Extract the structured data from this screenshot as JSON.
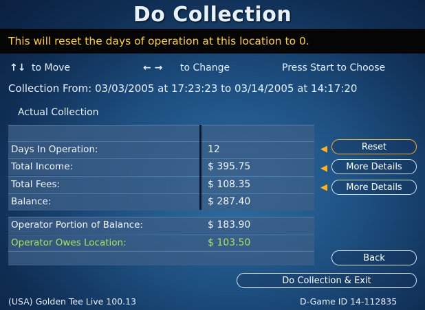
{
  "title": "Do Collection",
  "banner": "This will reset the days of operation at this location to 0.",
  "controls": {
    "move_icon": "↑↓",
    "move_label": "to Move",
    "change_icon": "← →",
    "change_label": "to Change",
    "start_label": "Press Start to Choose"
  },
  "collection_from": "Collection From: 03/03/2005 at 17:23:23 to 03/14/2005 at 14:17:20",
  "actual_label": "Actual Collection",
  "rows": [
    {
      "label": "",
      "value": ""
    },
    {
      "label": "Days In Operation:",
      "value": "12"
    },
    {
      "label": "Total Income:",
      "value": "$ 395.75"
    },
    {
      "label": "Total Fees:",
      "value": "$ 108.35"
    },
    {
      "label": "Balance:",
      "value": "$ 287.40"
    },
    {
      "label": "Operator Portion of Balance:",
      "value": "$ 183.90"
    },
    {
      "label": "Operator Owes Location:",
      "value": "$ 103.50"
    }
  ],
  "buttons": {
    "reset": "Reset",
    "more_details_1": "More Details",
    "more_details_2": "More Details",
    "back": "Back",
    "do_collection_exit": "Do Collection & Exit"
  },
  "footer": {
    "left": "(USA) Golden Tee Live 100.13",
    "right": "D-Game ID 14-112835"
  },
  "colors": {
    "banner_text": "#ffd21a",
    "highlight_green": "#a9e25a",
    "selected_outline": "#ffae2a"
  }
}
